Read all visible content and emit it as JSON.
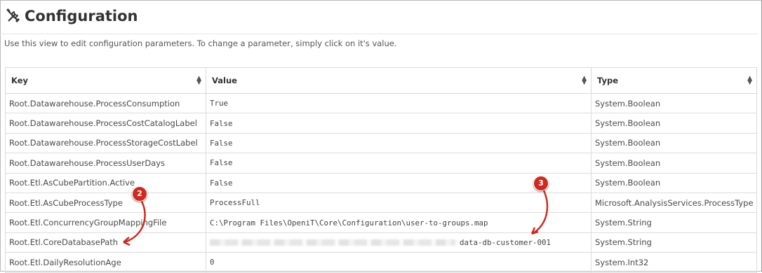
{
  "page": {
    "title": "Configuration",
    "description": "Use this view to edit configuration parameters. To change a parameter, simply click on it's value."
  },
  "table": {
    "columns": [
      "Key",
      "Value",
      "Type"
    ],
    "rows": [
      {
        "key": "Root.Datawarehouse.ProcessConsumption",
        "value": "True",
        "type": "System.Boolean"
      },
      {
        "key": "Root.Datawarehouse.ProcessCostCatalogLabel",
        "value": "False",
        "type": "System.Boolean"
      },
      {
        "key": "Root.Datawarehouse.ProcessStorageCostLabel",
        "value": "False",
        "type": "System.Boolean"
      },
      {
        "key": "Root.Datawarehouse.ProcessUserDays",
        "value": "False",
        "type": "System.Boolean"
      },
      {
        "key": "Root.Etl.AsCubePartition.Active",
        "value": "False",
        "type": "System.Boolean"
      },
      {
        "key": "Root.Etl.AsCubeProcessType",
        "value": "ProcessFull",
        "type": "Microsoft.AnalysisServices.ProcessType"
      },
      {
        "key": "Root.Etl.ConcurrencyGroupMappingFile",
        "value": "C:\\Program Files\\OpeniT\\Core\\Configuration\\user-to-groups.map",
        "type": "System.String"
      },
      {
        "key": "Root.Etl.CoreDatabasePath",
        "value": "data-db-customer-001",
        "type": "System.String"
      },
      {
        "key": "Root.Etl.DailyResolutionAge",
        "value": "0",
        "type": "System.Int32"
      }
    ]
  },
  "callouts": [
    "2",
    "3"
  ],
  "colors": {
    "callout": "#d02a1e"
  }
}
